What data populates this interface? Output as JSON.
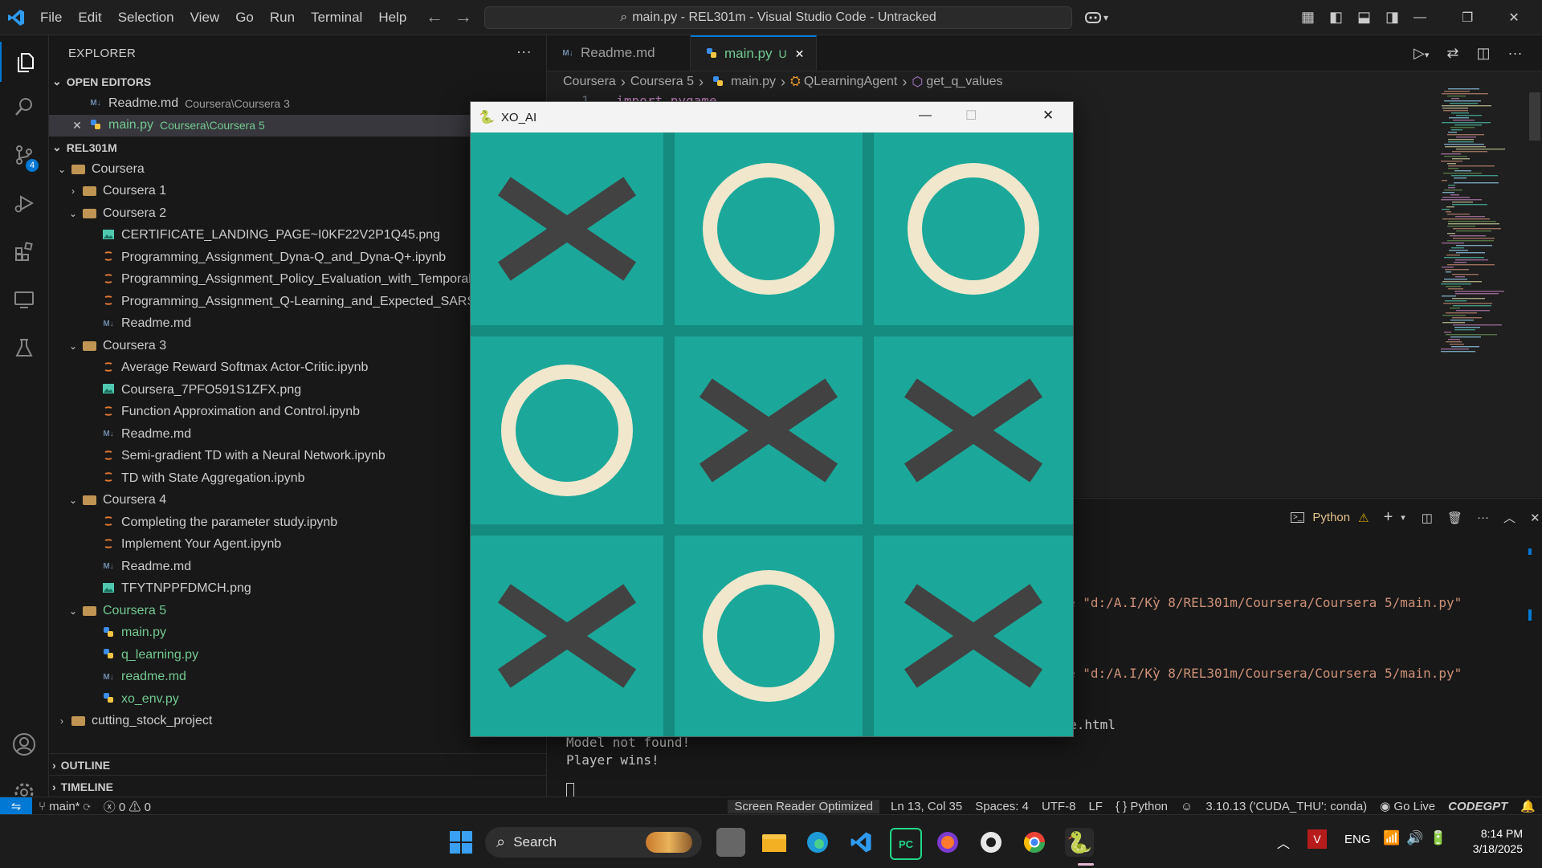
{
  "titlebar": {
    "menus": [
      "File",
      "Edit",
      "Selection",
      "View",
      "Go",
      "Run",
      "Terminal",
      "Help"
    ],
    "command_center": "main.py - REL301m - Visual Studio Code - Untracked"
  },
  "activity": {
    "source_control_badge": "4"
  },
  "explorer": {
    "header": "EXPLORER",
    "open_editors_label": "OPEN EDITORS",
    "open_editors": [
      {
        "name": "Readme.md",
        "path": "Coursera\\Coursera 3",
        "icon": "markdown-icon"
      },
      {
        "name": "main.py",
        "path": "Coursera\\Coursera 5",
        "icon": "python-icon"
      }
    ],
    "root_label": "REL301M",
    "tree": [
      {
        "depth": 1,
        "kind": "folder",
        "open": true,
        "name": "Coursera"
      },
      {
        "depth": 2,
        "kind": "folder",
        "open": false,
        "name": "Coursera 1"
      },
      {
        "depth": 2,
        "kind": "folder",
        "open": true,
        "name": "Coursera 2"
      },
      {
        "depth": 3,
        "kind": "png",
        "name": "CERTIFICATE_LANDING_PAGE~I0KF22V2P1Q45.png"
      },
      {
        "depth": 3,
        "kind": "nb",
        "name": "Programming_Assignment_Dyna-Q_and_Dyna-Q+.ipynb"
      },
      {
        "depth": 3,
        "kind": "nb",
        "name": "Programming_Assignment_Policy_Evaluation_with_Temporal_"
      },
      {
        "depth": 3,
        "kind": "nb",
        "name": "Programming_Assignment_Q-Learning_and_Expected_SARSA"
      },
      {
        "depth": 3,
        "kind": "md",
        "name": "Readme.md"
      },
      {
        "depth": 2,
        "kind": "folder",
        "open": true,
        "name": "Coursera 3"
      },
      {
        "depth": 3,
        "kind": "nb",
        "name": "Average Reward Softmax Actor-Critic.ipynb"
      },
      {
        "depth": 3,
        "kind": "png",
        "name": "Coursera_7PFO591S1ZFX.png"
      },
      {
        "depth": 3,
        "kind": "nb",
        "name": "Function Approximation and Control.ipynb"
      },
      {
        "depth": 3,
        "kind": "md",
        "name": "Readme.md"
      },
      {
        "depth": 3,
        "kind": "nb",
        "name": "Semi-gradient TD with a Neural Network.ipynb"
      },
      {
        "depth": 3,
        "kind": "nb",
        "name": "TD with State Aggregation.ipynb"
      },
      {
        "depth": 2,
        "kind": "folder",
        "open": true,
        "name": "Coursera 4"
      },
      {
        "depth": 3,
        "kind": "nb",
        "name": "Completing the parameter study.ipynb"
      },
      {
        "depth": 3,
        "kind": "nb",
        "name": "Implement Your Agent.ipynb"
      },
      {
        "depth": 3,
        "kind": "md",
        "name": "Readme.md"
      },
      {
        "depth": 3,
        "kind": "png",
        "name": "TFYTNPPFDMCH.png"
      },
      {
        "depth": 2,
        "kind": "folder",
        "open": true,
        "name": "Coursera 5",
        "green": true
      },
      {
        "depth": 3,
        "kind": "py",
        "name": "main.py",
        "green": true
      },
      {
        "depth": 3,
        "kind": "py",
        "name": "q_learning.py",
        "green": true
      },
      {
        "depth": 3,
        "kind": "md",
        "name": "readme.md",
        "green": true
      },
      {
        "depth": 3,
        "kind": "py",
        "name": "xo_env.py",
        "green": true
      },
      {
        "depth": 1,
        "kind": "folder",
        "open": false,
        "name": "cutting_stock_project"
      }
    ],
    "outline_label": "OUTLINE",
    "timeline_label": "TIMELINE"
  },
  "tabs": [
    {
      "label": "Readme.md",
      "icon": "markdown-icon",
      "active": false,
      "badge": ""
    },
    {
      "label": "main.py",
      "icon": "python-icon",
      "active": true,
      "badge": "U"
    }
  ],
  "breadcrumb": [
    "Coursera",
    "Coursera 5",
    "main.py",
    "QLearningAgent",
    "get_q_values"
  ],
  "editor": {
    "line_no": "1",
    "code": "import pygame"
  },
  "panel": {
    "terminal_name": "Python",
    "lines": [
      {
        "text": "l",
        "str": ""
      },
      {
        "text": "e ",
        "str": "\"d:/A.I/Kỳ 8/REL301m/Coursera/Coursera 5/main.py\""
      },
      {
        "text": "l",
        "str": ""
      },
      {
        "text": "e ",
        "str": "\"d:/A.I/Kỳ 8/REL301m/Coursera/Coursera 5/main.py\""
      },
      {
        "text": "Hello from the pygame community. https://www.pygame.org/contribute.html",
        "str": ""
      },
      {
        "text": "Model not found!",
        "str": ""
      },
      {
        "text": "Player wins!",
        "str": ""
      }
    ]
  },
  "statusbar": {
    "branch": "main*",
    "errors": "0",
    "warnings": "0",
    "screen_reader": "Screen Reader Optimized",
    "position": "Ln 13, Col 35",
    "spaces": "Spaces: 4",
    "encoding": "UTF-8",
    "eol": "LF",
    "language": "Python",
    "interpreter": "3.10.13 ('CUDA_THU': conda)",
    "golive": "Go Live",
    "codegpt": "CODEGPT"
  },
  "game": {
    "title": "XO_AI",
    "board": [
      "X",
      "O",
      "O",
      "O",
      "X",
      "X",
      "X",
      "O",
      "X"
    ],
    "colors": {
      "bg": "#1ba89a",
      "lines": "#158a7f",
      "x": "#424242",
      "o": "#f0e7cc"
    }
  },
  "taskbar": {
    "search_label": "Search",
    "language": "ENG",
    "time": "8:14 PM",
    "date": "3/18/2025"
  }
}
